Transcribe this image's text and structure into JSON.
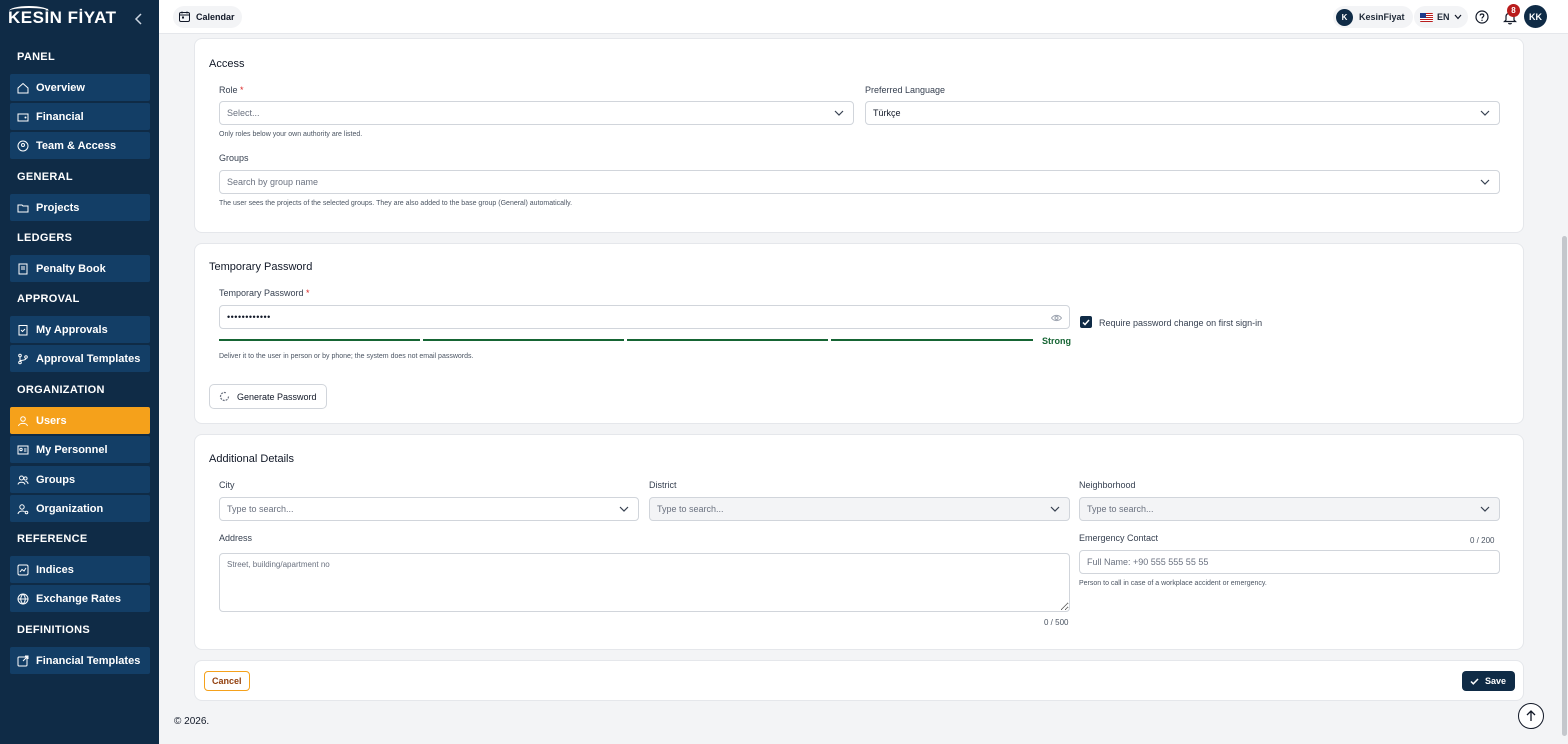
{
  "brand": {
    "logo_text": "KESİN FİYAT"
  },
  "sidebar": {
    "sections": [
      {
        "title": "PANEL",
        "items": [
          "Overview",
          "Financial",
          "Team & Access"
        ]
      },
      {
        "title": "GENERAL",
        "items": [
          "Projects"
        ]
      },
      {
        "title": "LEDGERS",
        "items": [
          "Penalty Book"
        ]
      },
      {
        "title": "APPROVAL",
        "items": [
          "My Approvals",
          "Approval Templates"
        ]
      },
      {
        "title": "ORGANIZATION",
        "items": [
          "Users",
          "My Personnel",
          "Groups",
          "Organization"
        ]
      },
      {
        "title": "REFERENCE",
        "items": [
          "Indices",
          "Exchange Rates"
        ]
      },
      {
        "title": "DEFINITIONS",
        "items": [
          "Financial Templates"
        ]
      }
    ],
    "active_item": "Users"
  },
  "topbar": {
    "calendar_label": "Calendar",
    "user_initial": "K",
    "user_name": "KesinFiyat",
    "language": "EN",
    "notification_count": "8",
    "avatar_initials": "KK"
  },
  "access": {
    "title": "Access",
    "role_label": "Role",
    "role_required": "*",
    "role_placeholder": "Select...",
    "role_hint": "Only roles below your own authority are listed.",
    "language_label": "Preferred Language",
    "language_value": "Türkçe",
    "groups_label": "Groups",
    "groups_placeholder": "Search by group name",
    "groups_hint": "The user sees the projects of the selected groups. They are also added to the base group (General) automatically."
  },
  "password": {
    "title": "Temporary Password",
    "label": "Temporary Password",
    "required": "*",
    "value": "••••••••••••",
    "strength_label": "Strong",
    "strength_fraction": 1.0,
    "require_change_label": "Require password change on first sign-in",
    "require_change_checked": true,
    "hint": "Deliver it to the user in person or by phone; the system does not email passwords.",
    "generate_label": "Generate Password"
  },
  "details": {
    "title": "Additional Details",
    "city_label": "City",
    "city_placeholder": "Type to search...",
    "district_label": "District",
    "district_placeholder": "Type to search...",
    "neighborhood_label": "Neighborhood",
    "neighborhood_placeholder": "Type to search...",
    "address_label": "Address",
    "address_placeholder": "Street, building/apartment no",
    "address_counter": "0 / 500",
    "emergency_label": "Emergency Contact",
    "emergency_counter": "0 / 200",
    "emergency_placeholder": "Full Name: +90 555 555 55 55",
    "emergency_hint": "Person to call in case of a workplace accident or emergency."
  },
  "actions": {
    "cancel_label": "Cancel",
    "save_label": "Save"
  },
  "footer": {
    "copyright": "© 2026."
  },
  "colors": {
    "sidebar_bg": "#0f2b46",
    "nav_bg": "#133e66",
    "accent": "#f5a11b",
    "strength": "#166534"
  }
}
